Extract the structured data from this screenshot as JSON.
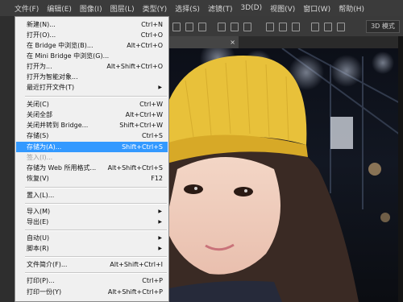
{
  "menubar": {
    "items": [
      "文件(F)",
      "编辑(E)",
      "图像(I)",
      "图层(L)",
      "类型(Y)",
      "选择(S)",
      "滤镜(T)",
      "3D(D)",
      "视图(V)",
      "窗口(W)",
      "帮助(H)"
    ]
  },
  "optbar": {
    "mode_label": "3D 模式"
  },
  "doc_tab": {
    "title": "",
    "close": "×"
  },
  "file_menu": {
    "items": [
      {
        "label": "新建(N)...",
        "shortcut": "Ctrl+N"
      },
      {
        "label": "打开(O)...",
        "shortcut": "Ctrl+O"
      },
      {
        "label": "在 Bridge 中浏览(B)...",
        "shortcut": "Alt+Ctrl+O"
      },
      {
        "label": "在 Mini Bridge 中浏览(G)...",
        "shortcut": ""
      },
      {
        "label": "打开为...",
        "shortcut": "Alt+Shift+Ctrl+O"
      },
      {
        "label": "打开为智能对象...",
        "shortcut": ""
      },
      {
        "label": "最近打开文件(T)",
        "shortcut": ""
      },
      {
        "label": "关闭(C)",
        "shortcut": "Ctrl+W"
      },
      {
        "label": "关闭全部",
        "shortcut": "Alt+Ctrl+W"
      },
      {
        "label": "关闭并转到 Bridge...",
        "shortcut": "Shift+Ctrl+W"
      },
      {
        "label": "存储(S)",
        "shortcut": "Ctrl+S"
      },
      {
        "label": "存储为(A)...",
        "shortcut": "Shift+Ctrl+S"
      },
      {
        "label": "签入(I)...",
        "shortcut": ""
      },
      {
        "label": "存储为 Web 所用格式...",
        "shortcut": "Alt+Shift+Ctrl+S"
      },
      {
        "label": "恢复(V)",
        "shortcut": "F12"
      },
      {
        "label": "置入(L)...",
        "shortcut": ""
      },
      {
        "label": "导入(M)",
        "shortcut": ""
      },
      {
        "label": "导出(E)",
        "shortcut": ""
      },
      {
        "label": "自动(U)",
        "shortcut": ""
      },
      {
        "label": "脚本(R)",
        "shortcut": ""
      },
      {
        "label": "文件简介(F)...",
        "shortcut": "Alt+Shift+Ctrl+I"
      },
      {
        "label": "打印(P)...",
        "shortcut": "Ctrl+P"
      },
      {
        "label": "打印一份(Y)",
        "shortcut": "Alt+Shift+Ctrl+P"
      }
    ],
    "submenu_arrow": "▶"
  },
  "colors": {
    "highlight": "#3399ff",
    "menu_bg": "#f0f0f0",
    "hat": "#e8c13a"
  }
}
